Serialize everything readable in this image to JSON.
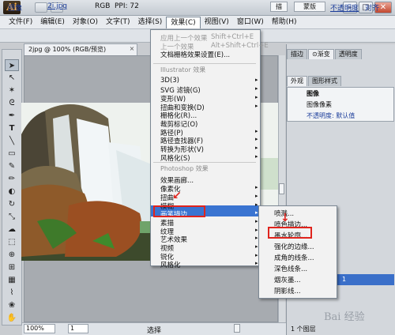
{
  "app": {
    "logo": "Ai"
  },
  "menubar": {
    "items": [
      "文件(F)",
      "编辑(E)",
      "对象(O)",
      "文字(T)",
      "选择(S)",
      "效果(C)",
      "视图(V)",
      "窗口(W)",
      "帮助(H)"
    ],
    "active_index": 5
  },
  "controlbar": {
    "label": "图像",
    "file": "2i.jpg",
    "mode": "RGB",
    "ppi_label": "PPI: 72",
    "ppi_value": "",
    "btn1": "描",
    "mask": "蒙版",
    "opacity": "不透明度",
    "align": "对齐"
  },
  "document": {
    "tab_title": "2jpg @ 100% (RGB/预览)",
    "close_label": "×",
    "zoom": "100%",
    "page": "1",
    "status": "选择"
  },
  "panels": {
    "tabs_top": [
      "描边",
      "⊙渐变",
      "透明度"
    ],
    "tabs_mid": [
      "外观",
      "图形样式"
    ],
    "appearance_rows": [
      "图像",
      "图像像素",
      "不透明度: 默认值"
    ],
    "layer_name": "1",
    "layer_count": "1 个图层"
  },
  "effect_menu": {
    "items": [
      {
        "label": "应用上一个效果",
        "shortcut": "Shift+Ctrl+E",
        "disabled": true
      },
      {
        "label": "上一个效果",
        "shortcut": "Alt+Shift+Ctrl+E",
        "disabled": true
      },
      {
        "label": "文档栅格效果设置(E)..."
      },
      {
        "header": "Illustrator 效果"
      },
      {
        "label": "3D(3)",
        "submenu": true
      },
      {
        "label": "SVG 滤镜(G)",
        "submenu": true
      },
      {
        "label": "变形(W)",
        "submenu": true
      },
      {
        "label": "扭曲和变换(D)",
        "submenu": true
      },
      {
        "label": "栅格化(R)..."
      },
      {
        "label": "裁剪标记(O)"
      },
      {
        "label": "路径(P)",
        "submenu": true
      },
      {
        "label": "路径查找器(F)",
        "submenu": true
      },
      {
        "label": "转换为形状(V)",
        "submenu": true
      },
      {
        "label": "风格化(S)",
        "submenu": true
      },
      {
        "header": "Photoshop 效果"
      },
      {
        "label": "效果画廊..."
      },
      {
        "label": "像素化",
        "submenu": true
      },
      {
        "label": "扭曲",
        "submenu": true
      },
      {
        "label": "模糊",
        "submenu": true
      },
      {
        "label": "画笔描边",
        "submenu": true,
        "highlighted": true
      },
      {
        "label": "素描",
        "submenu": true
      },
      {
        "label": "纹理",
        "submenu": true
      },
      {
        "label": "艺术效果",
        "submenu": true
      },
      {
        "label": "视频",
        "submenu": true
      },
      {
        "label": "锐化",
        "submenu": true
      },
      {
        "label": "风格化",
        "submenu": true
      }
    ]
  },
  "submenu": {
    "items": [
      "喷溅...",
      "喷色描边...",
      "墨水轮廓...",
      "强化的边缘...",
      "成角的线条...",
      "深色线条...",
      "烟灰墨...",
      "阴影线..."
    ],
    "boxed_index": 2
  },
  "watermark": "Bai 经验"
}
